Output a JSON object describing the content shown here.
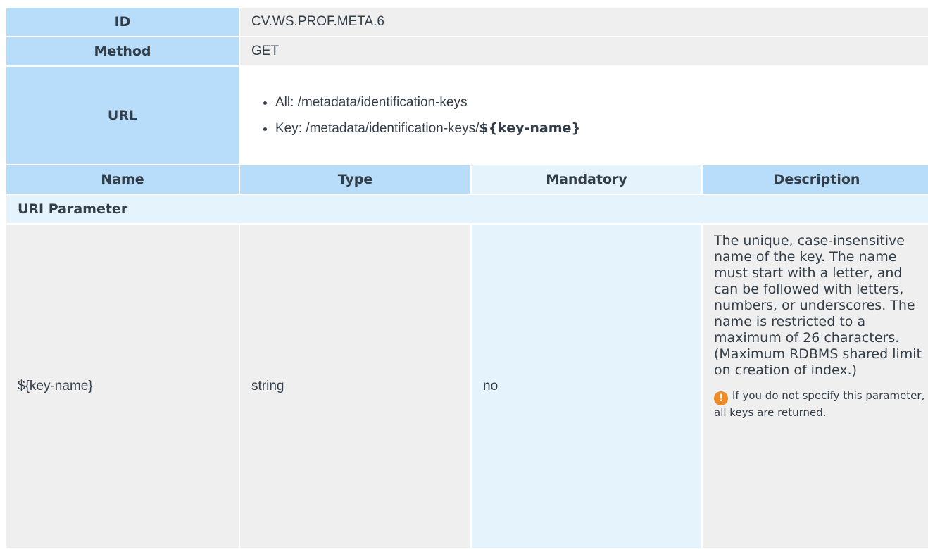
{
  "info": {
    "id_label": "ID",
    "id_value": "CV.WS.PROF.META.6",
    "method_label": "Method",
    "method_value": "GET",
    "url_label": "URL",
    "url_items": [
      {
        "prefix": "All: /metadata/identification-keys",
        "bold": ""
      },
      {
        "prefix": "Key: /metadata/identification-keys/",
        "bold": "${key-name}"
      }
    ]
  },
  "columns": {
    "name": "Name",
    "type": "Type",
    "mandatory": "Mandatory",
    "description": "Description"
  },
  "section": {
    "title": "URI Parameter"
  },
  "params": [
    {
      "name": "${key-name}",
      "type": "string",
      "mandatory": "no",
      "description": "The unique, case-insensitive name of the key. The name must start with a letter, and can be followed with letters, numbers, or underscores. The name is restricted to a maximum of 26 characters. (Maximum RDBMS shared limit on creation of index.)",
      "note_icon": "warning-icon",
      "note_icon_glyph": "!",
      "note": "If you do not specify this parameter, all keys are returned."
    }
  ],
  "colors": {
    "label_bg": "#b7ddfb",
    "light_bg": "#e5f3fd",
    "gray_bg": "#efefef",
    "warning": "#f08a24",
    "text": "#333e48"
  }
}
